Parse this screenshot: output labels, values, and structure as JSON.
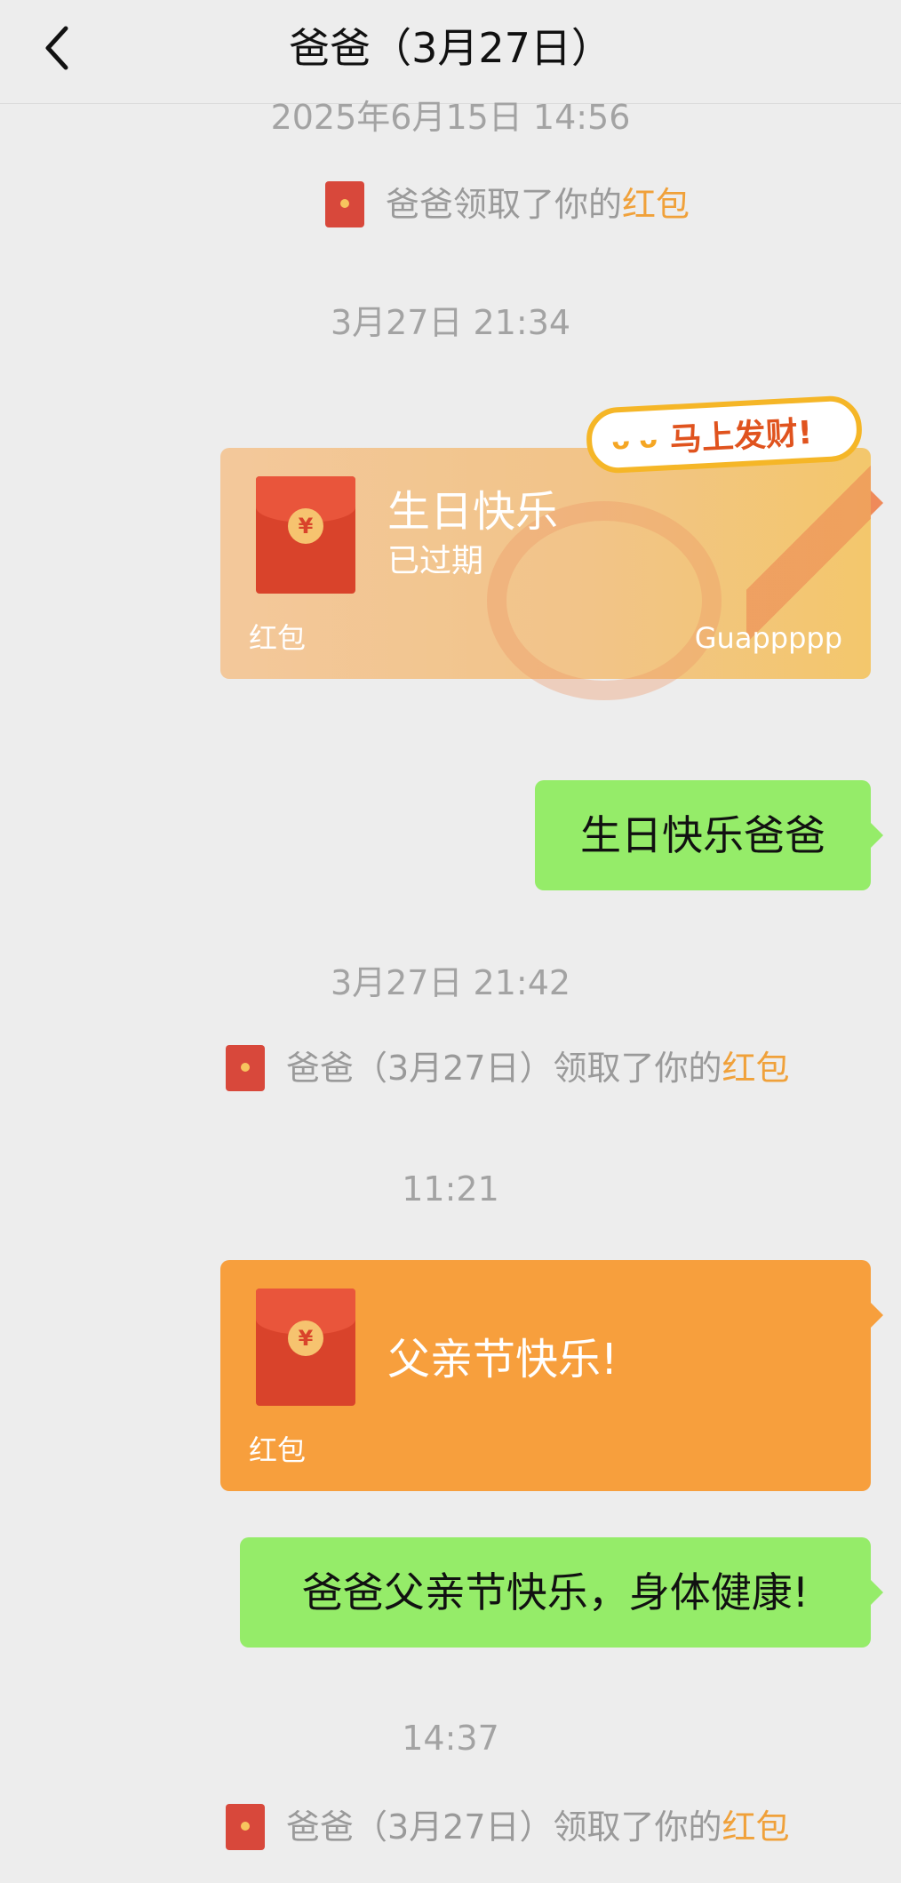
{
  "header": {
    "title": "爸爸（3月27日）"
  },
  "timestamps": {
    "t1": "2025年6月15日 14:56",
    "t2": "3月27日 21:34",
    "t3": "3月27日 21:42",
    "t4": "11:21",
    "t5": "14:37"
  },
  "system": {
    "s1": {
      "prefix": "爸爸领取了你的",
      "link": "红包"
    },
    "s2": {
      "prefix": "爸爸（3月27日）领取了你的",
      "link": "红包"
    },
    "s3": {
      "prefix": "爸爸（3月27日）领取了你的",
      "link": "红包"
    }
  },
  "red_packet_1": {
    "message": "生日快乐",
    "status": "已过期",
    "label": "红包",
    "sender": "Guappppp",
    "sticker": "马上发财!",
    "coin": "¥"
  },
  "text_1": "生日快乐爸爸",
  "red_packet_2": {
    "message": "父亲节快乐!",
    "label": "红包",
    "coin": "¥"
  },
  "text_2": "爸爸父亲节快乐，身体健康!",
  "colors": {
    "background": "#ededed",
    "bubble_green": "#95ec69",
    "packet_orange": "#f79f3d",
    "link_orange": "#f0a13a",
    "timestamp_gray": "#a3a3a3"
  },
  "icons": {
    "back": "chevron-left-icon",
    "packet": "red-envelope-icon"
  }
}
